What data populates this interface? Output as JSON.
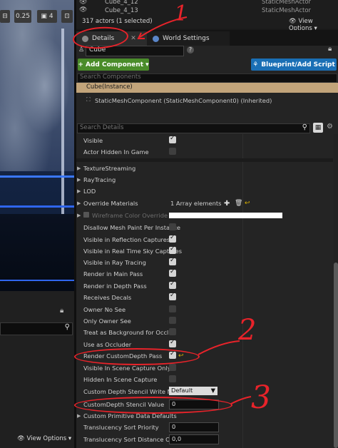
{
  "viewport": {
    "zoom_value": "0.25",
    "grid_value": "4",
    "view_options": "View Options"
  },
  "outliner": {
    "items": [
      {
        "name": "Cube_4_12",
        "type": "StaticMeshActor"
      },
      {
        "name": "Cube_4_13",
        "type": "StaticMeshActor"
      }
    ],
    "status": "317 actors (1 selected)",
    "view_options": "View Options"
  },
  "tabs": {
    "details": "Details",
    "world_settings": "World Settings"
  },
  "details": {
    "actor_name": "Cube",
    "add_component": "+ Add Component ▾",
    "blueprint_button": "Blueprint/Add Script",
    "search_components_placeholder": "Search Components",
    "instance_label": "Cube(Instance)",
    "component_label": "StaticMeshComponent (StaticMeshComponent0) (Inherited)",
    "search_details_placeholder": "Search Details"
  },
  "properties": {
    "visible": "Visible",
    "actor_hidden": "Actor Hidden In Game",
    "texture_streaming": "TextureStreaming",
    "ray_tracing": "RayTracing",
    "lod": "LOD",
    "override_materials": "Override Materials",
    "override_value": "1 Array elements",
    "wireframe": "Wireframe Color Override",
    "disallow_paint": "Disallow Mesh Paint Per Instance",
    "vis_reflection": "Visible in Reflection Captures",
    "vis_realtime_sky": "Visible in Real Time Sky Captures",
    "vis_raytracing": "Visible in Ray Tracing",
    "render_main": "Render in Main Pass",
    "render_depth": "Render in Depth Pass",
    "receives_decals": "Receives Decals",
    "owner_no_see": "Owner No See",
    "only_owner_see": "Only Owner See",
    "treat_background": "Treat as Background for Occlusion",
    "use_occluder": "Use as Occluder",
    "render_custom_depth": "Render CustomDepth Pass",
    "visible_scene_capture": "Visible In Scene Capture Only",
    "hidden_scene_capture": "Hidden In Scene Capture",
    "stencil_write_mask": "Custom Depth Stencil Write Mask",
    "stencil_write_mask_value": "Default",
    "stencil_value": "CustomDepth Stencil Value",
    "stencil_value_value": "0",
    "custom_primitive": "Custom Primitive Data Defaults",
    "translucency_priority": "Translucency Sort Priority",
    "translucency_priority_value": "0",
    "translucency_offset": "Translucency Sort Distance Offse",
    "translucency_offset_value": "0,0"
  },
  "annotations": {
    "one": "1",
    "two": "2",
    "three": "3"
  },
  "colors": {
    "add_component_green": "#4a8c2a",
    "blueprint_blue": "#1a6fb5",
    "instance_tan": "#c2a47a",
    "annotation_red": "#e8232a"
  }
}
